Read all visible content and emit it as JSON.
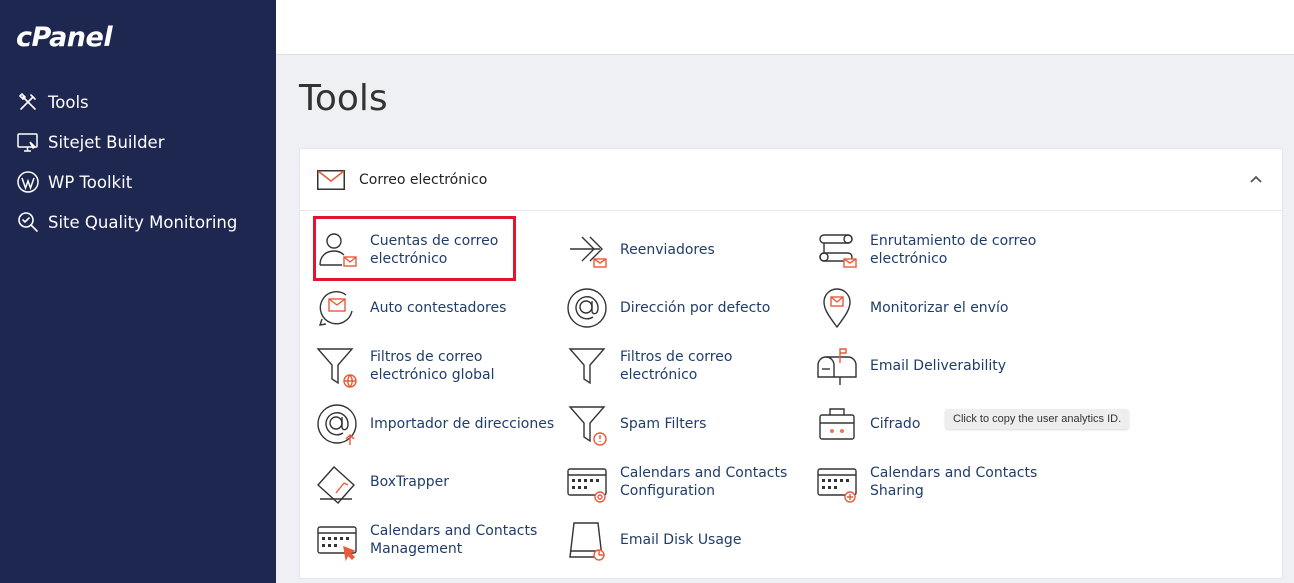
{
  "sidebar": {
    "logo": "cPanel",
    "items": [
      {
        "label": "Tools",
        "icon": "tools-icon"
      },
      {
        "label": "Sitejet Builder",
        "icon": "monitor-icon"
      },
      {
        "label": "WP Toolkit",
        "icon": "wordpress-icon"
      },
      {
        "label": "Site Quality Monitoring",
        "icon": "magnifier-icon"
      }
    ]
  },
  "page": {
    "title": "Tools"
  },
  "section": {
    "title": "Correo electrónico",
    "icon": "envelope-icon",
    "tools": [
      {
        "label": "Cuentas de correo electrónico",
        "icon": "user-mail-icon"
      },
      {
        "label": "Reenviadores",
        "icon": "forward-icon"
      },
      {
        "label": "Enrutamiento de correo electrónico",
        "icon": "routing-icon"
      },
      {
        "label": "Auto contestadores",
        "icon": "autoresponder-icon"
      },
      {
        "label": "Dirección por defecto",
        "icon": "at-sign-icon"
      },
      {
        "label": "Monitorizar el envío",
        "icon": "location-pin-icon"
      },
      {
        "label": "Filtros de correo electrónico global",
        "icon": "globe-filter-icon"
      },
      {
        "label": "Filtros de correo electrónico",
        "icon": "filter-icon"
      },
      {
        "label": "Email Deliverability",
        "icon": "mailbox-icon"
      },
      {
        "label": "Importador de direcciones",
        "icon": "import-at-icon"
      },
      {
        "label": "Spam Filters",
        "icon": "spam-filter-icon"
      },
      {
        "label": "Cifrado",
        "icon": "briefcase-icon"
      },
      {
        "label": "BoxTrapper",
        "icon": "box-trap-icon"
      },
      {
        "label": "Calendars and Contacts Configuration",
        "icon": "calendar-at-icon"
      },
      {
        "label": "Calendars and Contacts Sharing",
        "icon": "calendar-share-icon"
      },
      {
        "label": "Calendars and Contacts Management",
        "icon": "calendar-manage-icon"
      },
      {
        "label": "Email Disk Usage",
        "icon": "disk-usage-icon"
      }
    ]
  },
  "tooltip": {
    "text": "Click to copy the user analytics ID."
  },
  "colors": {
    "sidebar": "#1e2750",
    "accent": "#e95a3a",
    "link": "#1f3d6b",
    "highlight": "#e0152f"
  }
}
